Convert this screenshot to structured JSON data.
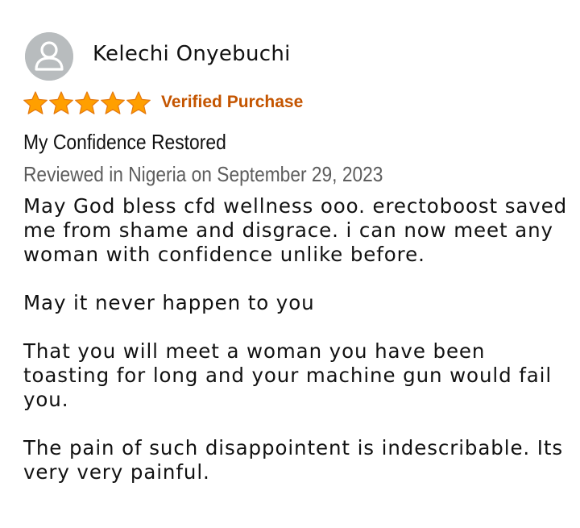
{
  "reviewer": {
    "name": "Kelechi Onyebuchi",
    "avatar_icon": "user-silhouette-icon"
  },
  "rating": {
    "stars": 5,
    "max": 5,
    "star_color": "#ff9f00",
    "star_outline": "#e47911"
  },
  "badge": {
    "label": "Verified Purchase",
    "color": "#c45500"
  },
  "review": {
    "title": "My Confidence Restored",
    "meta": "Reviewed in Nigeria on September 29, 2023",
    "paragraphs": [
      "May God bless cfd wellness ooo. erectoboost saved me from shame and disgrace. i can now meet any woman with confidence unlike before.",
      "May it never happen to you",
      "That you will meet a woman you have been toasting for long and your machine gun would fail you.",
      "The pain of such disappointent is indescribable. Its very very painful."
    ]
  }
}
